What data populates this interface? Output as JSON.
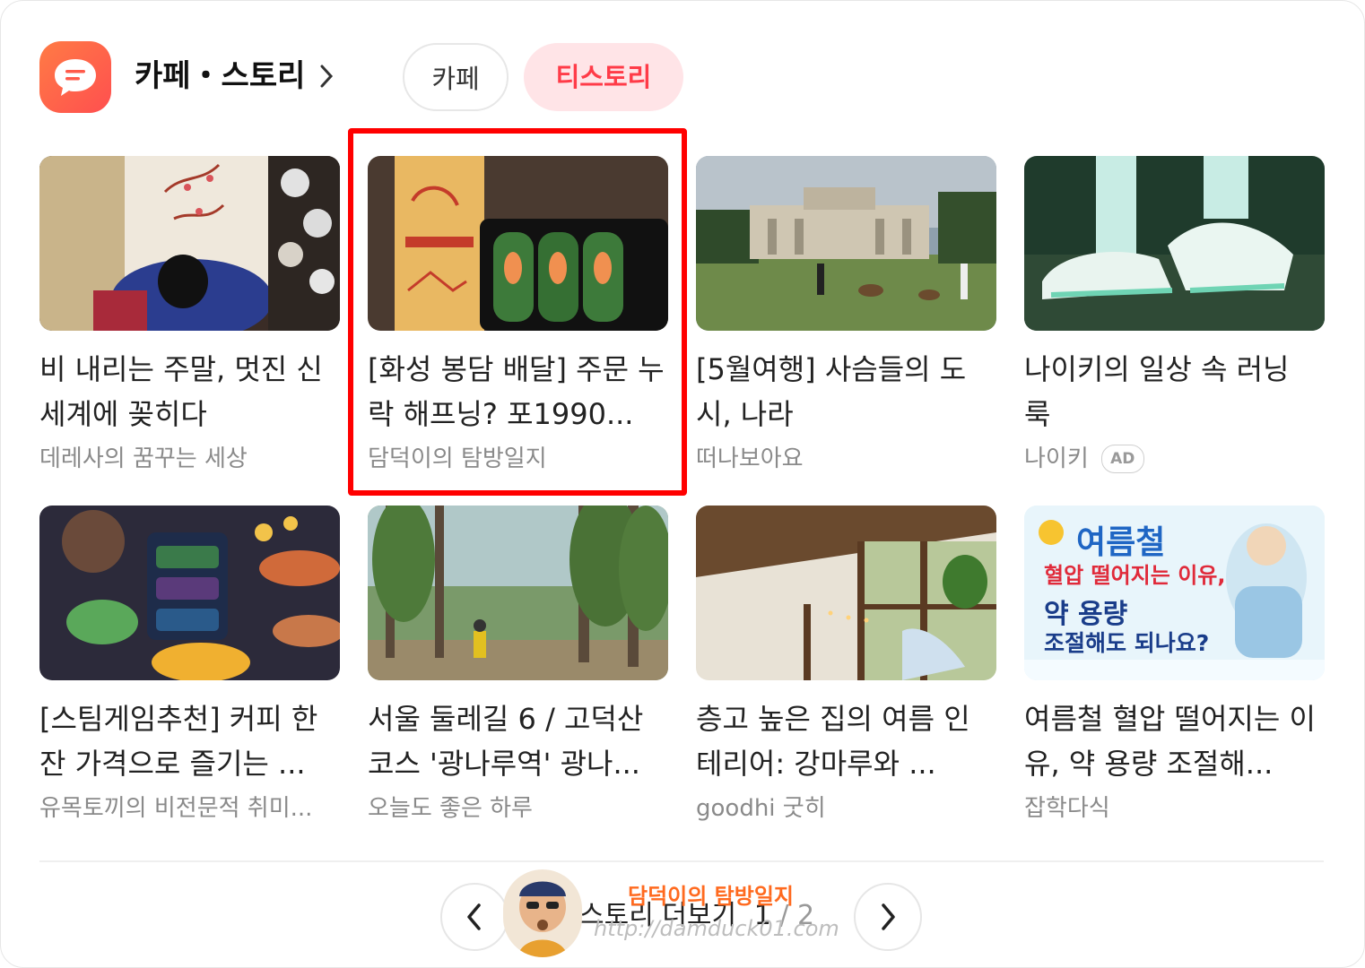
{
  "header": {
    "title": "카페・스토리",
    "tabs": [
      {
        "label": "카페",
        "selected": false
      },
      {
        "label": "티스토리",
        "selected": true
      }
    ]
  },
  "cards": [
    {
      "title": "비 내리는 주말, 멋진 신세계에 꽂히다",
      "source": "데레사의 꿈꾸는 세상",
      "thumb": "hanbok-table-photo"
    },
    {
      "title": "[화성 봉담 배달] 주문 누락 해프닝? 포1990...",
      "source": "담덕이의 탐방일지",
      "thumb": "banh-mi-spring-rolls-photo",
      "highlighted": true
    },
    {
      "title": "[5월여행] 사슴들의 도시, 나라",
      "source": "떠나보아요",
      "thumb": "nara-deer-park-photo"
    },
    {
      "title": "나이키의 일상 속 러닝 룩",
      "source": "나이키",
      "ad": "AD",
      "thumb": "running-shoes-photo"
    },
    {
      "title": "[스팀게임추천] 커피 한 잔 가격으로 즐기는 ...",
      "source": "유목토끼의 비전문적 취미...",
      "thumb": "game-art-illustration"
    },
    {
      "title": "서울 둘레길 6 / 고덕산 코스 '광나루역' 광나...",
      "source": "오늘도 좋은 하루",
      "thumb": "tree-lined-trail-photo"
    },
    {
      "title": "층고 높은 집의 여름 인테리어: 강마루와 ...",
      "source": "goodhi 굿히",
      "thumb": "high-ceiling-interior-photo"
    },
    {
      "title": "여름철 혈압 떨어지는 이유, 약 용량 조절해...",
      "source": "잡학다식",
      "thumb": "blood-pressure-infographic"
    }
  ],
  "infographic": {
    "line1": "여름철",
    "line2": "혈압 떨어지는 이유,",
    "line3": "약 용량",
    "line4": "조절해도 되나요?"
  },
  "pager": {
    "label": "스토리 더보기",
    "current": "1",
    "total": "2"
  },
  "watermark": {
    "name": "담덕이의 탐방일지",
    "url": "http://damduck01.com"
  },
  "colors": {
    "accent": "#ff3b48",
    "tab_selected_bg": "#ffe4e7",
    "highlight_box": "#ff0000",
    "app_icon": "#ff5a4a"
  }
}
